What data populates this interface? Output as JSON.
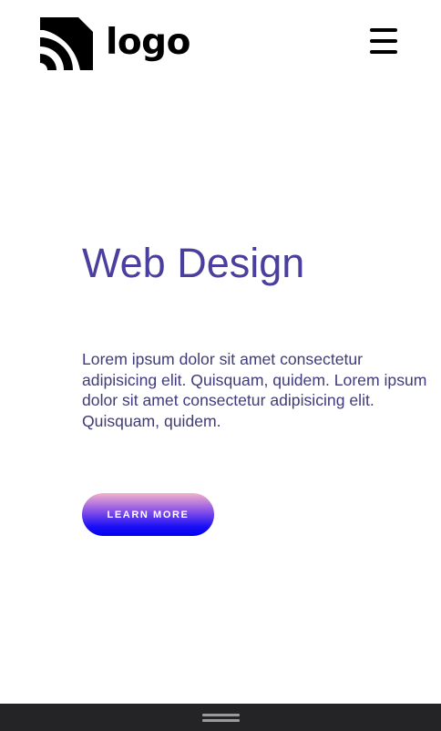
{
  "header": {
    "logo_text": "logo",
    "menu_icon": "hamburger-menu-icon"
  },
  "hero": {
    "title": "Web Design",
    "body": "Lorem ipsum dolor sit amet consectetur adipisicing elit. Quisquam, quidem. Lorem ipsum dolor sit amet consectetur adipisicing elit. Quisquam, quidem.",
    "cta_label": "LEARN MORE"
  },
  "colors": {
    "title": "#4a3f9e",
    "body_text": "#3f3b7c",
    "button_gradient_top": "#f2b3cc",
    "button_gradient_bottom": "#0000f0",
    "bottom_bar": "#242426"
  },
  "bottom_bar": {
    "icon": "drag-handle-icon"
  }
}
